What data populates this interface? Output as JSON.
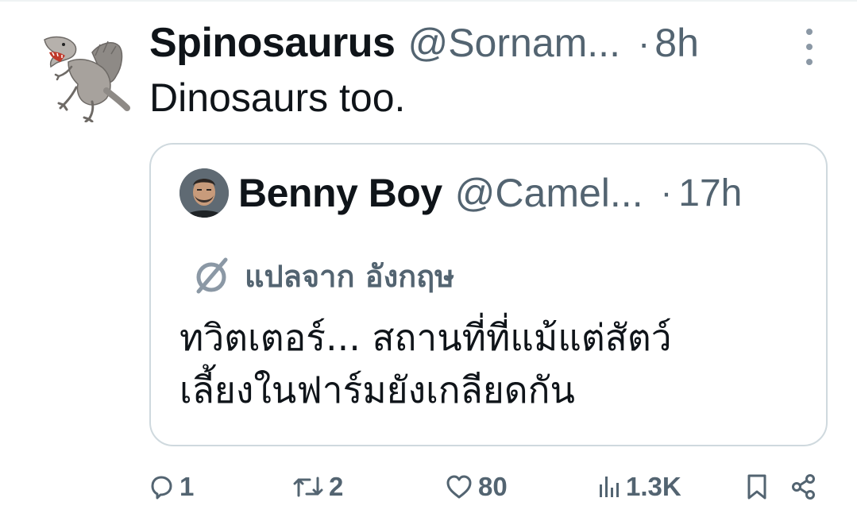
{
  "tweet": {
    "author_name": "Spinosaurus",
    "author_handle": "@Sornam...",
    "separator": "·",
    "time": "8h",
    "text": "Dinosaurs too.",
    "avatar_icon": "spinosaurus-avatar"
  },
  "quoted_tweet": {
    "author_name": "Benny Boy",
    "author_handle": "@Camel...",
    "separator": "·",
    "time": "17h",
    "translate_label": "แปลจาก อังกฤษ",
    "translate_icon": "translate-icon",
    "text_lines": [
      "ทวิตเตอร์... สถานที่ที่แม้แต่สัตว์",
      "เลี้ยงในฟาร์มยังเกลียดกัน"
    ]
  },
  "actions": {
    "reply_count": "1",
    "retweet_count": "2",
    "like_count": "80",
    "views_count": "1.3K"
  },
  "colors": {
    "text_primary": "#0f1419",
    "text_secondary": "#536471",
    "border": "#cfd9de"
  }
}
